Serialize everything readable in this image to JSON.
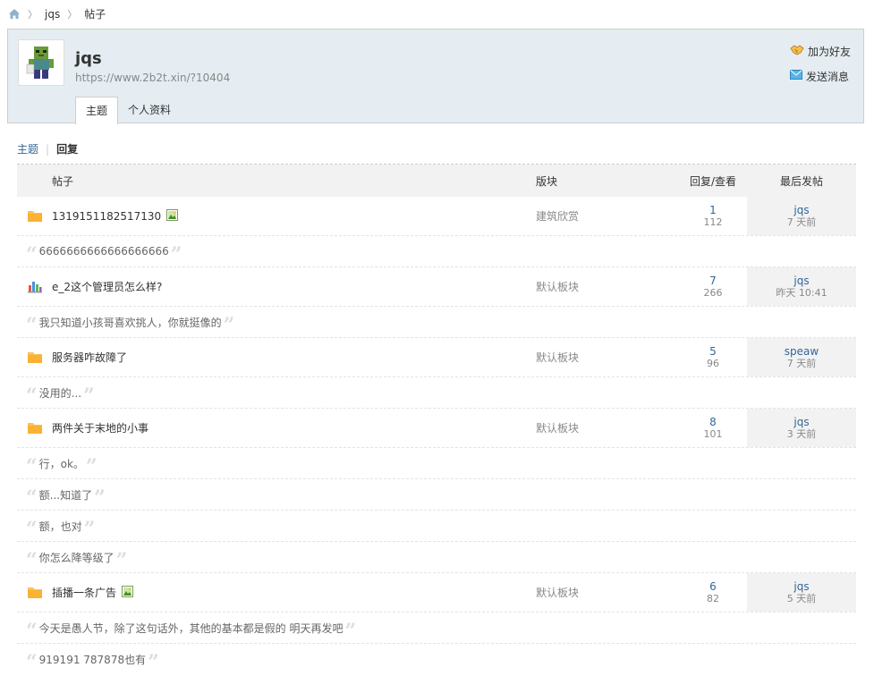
{
  "breadcrumb": {
    "items": [
      "jqs",
      "帖子"
    ]
  },
  "profile": {
    "name": "jqs",
    "url": "https://www.2b2t.xin/?10404",
    "tabs": [
      {
        "label": "主题",
        "active": true
      },
      {
        "label": "个人资料",
        "active": false
      }
    ],
    "actions": {
      "add_friend": "加为好友",
      "send_message": "发送消息"
    }
  },
  "type_switch": {
    "threads": "主题",
    "replies": "回复"
  },
  "table": {
    "headers": {
      "title": "帖子",
      "forum": "版块",
      "stats": "回复/查看",
      "last": "最后发帖"
    },
    "rows": [
      {
        "kind": "thread",
        "icon": "folder-icon",
        "title": "1319151182517130",
        "attachment": true,
        "forum": "建筑欣赏",
        "replies": "1",
        "views": "112",
        "last_user": "jqs",
        "last_time": "7 天前"
      },
      {
        "kind": "quote",
        "text": "6666666666666666666"
      },
      {
        "kind": "thread",
        "icon": "poll-icon",
        "title": "e_2这个管理员怎么样?",
        "attachment": false,
        "forum": "默认板块",
        "replies": "7",
        "views": "266",
        "last_user": "jqs",
        "last_time": "昨天 10:41"
      },
      {
        "kind": "quote",
        "text": "我只知道小孩哥喜欢挑人，你就挺像的"
      },
      {
        "kind": "thread",
        "icon": "folder-icon",
        "title": "服务器咋故障了",
        "attachment": false,
        "forum": "默认板块",
        "replies": "5",
        "views": "96",
        "last_user": "speaw",
        "last_time": "7 天前"
      },
      {
        "kind": "quote",
        "text": "没用的..."
      },
      {
        "kind": "thread",
        "icon": "folder-icon",
        "title": "两件关于末地的小事",
        "attachment": false,
        "forum": "默认板块",
        "replies": "8",
        "views": "101",
        "last_user": "jqs",
        "last_time": "3 天前"
      },
      {
        "kind": "quote",
        "text": "行，ok。"
      },
      {
        "kind": "quote",
        "text": "额...知道了"
      },
      {
        "kind": "quote",
        "text": "额，也对"
      },
      {
        "kind": "quote",
        "text": "你怎么降等级了"
      },
      {
        "kind": "thread",
        "icon": "folder-icon",
        "title": "插播一条广告",
        "attachment": true,
        "forum": "默认板块",
        "replies": "6",
        "views": "82",
        "last_user": "jqs",
        "last_time": "5 天前"
      },
      {
        "kind": "quote",
        "text": "今天是愚人节，除了这句话外，其他的基本都是假的 明天再发吧"
      },
      {
        "kind": "quote",
        "text": "919191 787878也有"
      }
    ]
  },
  "colors": {
    "header_bg": "#e5edf2",
    "link": "#336699",
    "folder": "#f9b233"
  }
}
